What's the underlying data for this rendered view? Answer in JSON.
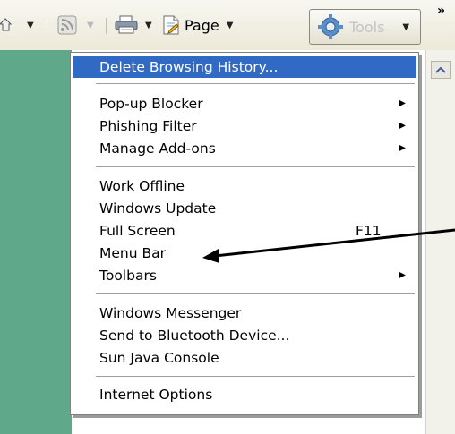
{
  "toolbar": {
    "page_label": "Page",
    "tools_label": "Tools",
    "chevrons": "»"
  },
  "menu": {
    "items": [
      {
        "label": "Delete Browsing History...",
        "selected": true
      },
      {
        "label": "Pop-up Blocker",
        "submenu": true
      },
      {
        "label": "Phishing Filter",
        "submenu": true
      },
      {
        "label": "Manage Add-ons",
        "submenu": true
      },
      {
        "label": "Work Offline"
      },
      {
        "label": "Windows Update"
      },
      {
        "label": "Full Screen",
        "shortcut": "F11"
      },
      {
        "label": "Menu Bar"
      },
      {
        "label": "Toolbars",
        "submenu": true
      },
      {
        "label": "Windows Messenger"
      },
      {
        "label": "Send to Bluetooth Device..."
      },
      {
        "label": "Sun Java Console"
      },
      {
        "label": "Internet Options"
      }
    ]
  },
  "colors": {
    "selection": "#316ac5",
    "page_background": "#5fa88a",
    "toolbar": "#ece9d8"
  }
}
